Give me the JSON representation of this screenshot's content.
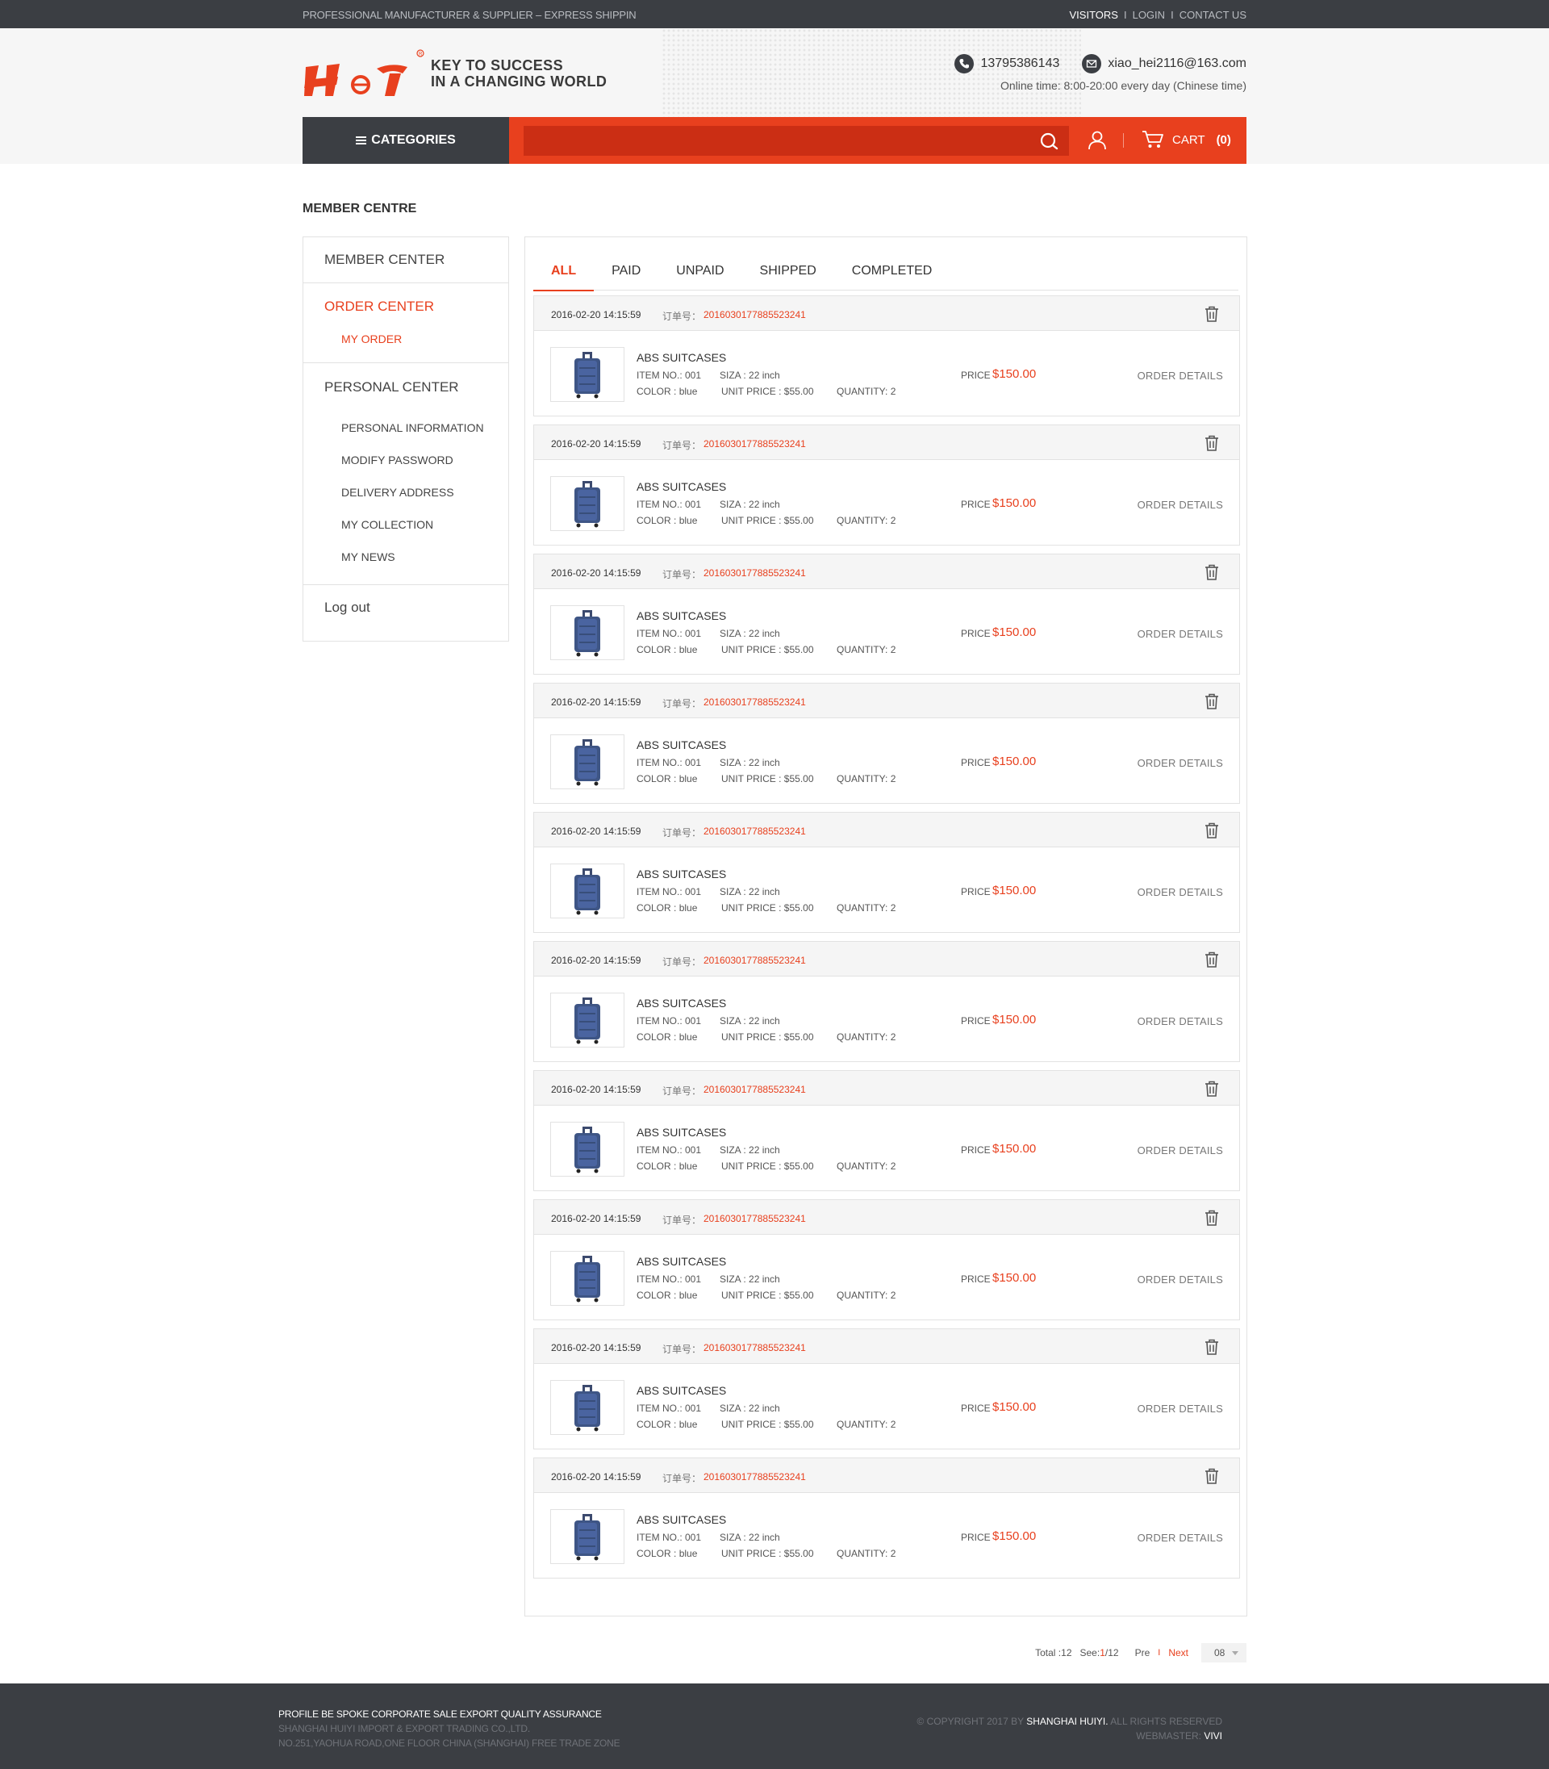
{
  "topbar": {
    "tagline": "PROFESSIONAL MANUFACTURER & SUPPLIER – EXPRESS SHIPPIN",
    "links": [
      "VISITORS",
      "LOGIN",
      "CONTACT US"
    ]
  },
  "header": {
    "logo_text": "H Y",
    "slogan_line1": "KEY TO SUCCESS",
    "slogan_line2": "IN A CHANGING WORLD",
    "phone": "13795386143",
    "email": "xiao_hei2116@163.com",
    "online_time": "Online time: 8:00-20:00 every day (Chinese time)"
  },
  "nav": {
    "categories_label": "CATEGORIES",
    "search_placeholder": "",
    "cart_label": "CART",
    "cart_count": "(0)"
  },
  "page_title": "MEMBER CENTRE",
  "sidebar": {
    "member_center": "MEMBER CENTER",
    "order_center": "ORDER CENTER",
    "my_order": "MY ORDER",
    "personal_center": "PERSONAL CENTER",
    "personal_items": [
      "PERSONAL INFORMATION",
      "MODIFY PASSWORD",
      "DELIVERY ADDRESS",
      "MY COLLECTION",
      "MY NEWS"
    ],
    "logout": "Log out"
  },
  "tabs": [
    "ALL",
    "PAID",
    "UNPAID",
    "SHIPPED",
    "COMPLETED"
  ],
  "order_labels": {
    "order_no_label": "订单号：",
    "item_no_label": "ITEM NO.: ",
    "size_label": "SIZA : ",
    "color_label": "COLOR : ",
    "unit_price_label": "UNIT PRICE : ",
    "quantity_label": "QUANTITY: ",
    "price_label": "PRICE",
    "details_label": "ORDER DETAILS"
  },
  "orders": [
    {
      "date": "2016-02-20 14:15:59",
      "order_no": "2016030177885523241",
      "product": "ABS SUITCASES",
      "item_no": "001",
      "size": "22 inch",
      "color": "blue",
      "unit_price": "$55.00",
      "quantity": "2",
      "price": "$150.00"
    },
    {
      "date": "2016-02-20 14:15:59",
      "order_no": "2016030177885523241",
      "product": "ABS SUITCASES",
      "item_no": "001",
      "size": "22 inch",
      "color": "blue",
      "unit_price": "$55.00",
      "quantity": "2",
      "price": "$150.00"
    },
    {
      "date": "2016-02-20 14:15:59",
      "order_no": "2016030177885523241",
      "product": "ABS SUITCASES",
      "item_no": "001",
      "size": "22 inch",
      "color": "blue",
      "unit_price": "$55.00",
      "quantity": "2",
      "price": "$150.00"
    },
    {
      "date": "2016-02-20 14:15:59",
      "order_no": "2016030177885523241",
      "product": "ABS SUITCASES",
      "item_no": "001",
      "size": "22 inch",
      "color": "blue",
      "unit_price": "$55.00",
      "quantity": "2",
      "price": "$150.00"
    },
    {
      "date": "2016-02-20 14:15:59",
      "order_no": "2016030177885523241",
      "product": "ABS SUITCASES",
      "item_no": "001",
      "size": "22 inch",
      "color": "blue",
      "unit_price": "$55.00",
      "quantity": "2",
      "price": "$150.00"
    },
    {
      "date": "2016-02-20 14:15:59",
      "order_no": "2016030177885523241",
      "product": "ABS SUITCASES",
      "item_no": "001",
      "size": "22 inch",
      "color": "blue",
      "unit_price": "$55.00",
      "quantity": "2",
      "price": "$150.00"
    },
    {
      "date": "2016-02-20 14:15:59",
      "order_no": "2016030177885523241",
      "product": "ABS SUITCASES",
      "item_no": "001",
      "size": "22 inch",
      "color": "blue",
      "unit_price": "$55.00",
      "quantity": "2",
      "price": "$150.00"
    },
    {
      "date": "2016-02-20 14:15:59",
      "order_no": "2016030177885523241",
      "product": "ABS SUITCASES",
      "item_no": "001",
      "size": "22 inch",
      "color": "blue",
      "unit_price": "$55.00",
      "quantity": "2",
      "price": "$150.00"
    },
    {
      "date": "2016-02-20 14:15:59",
      "order_no": "2016030177885523241",
      "product": "ABS SUITCASES",
      "item_no": "001",
      "size": "22 inch",
      "color": "blue",
      "unit_price": "$55.00",
      "quantity": "2",
      "price": "$150.00"
    },
    {
      "date": "2016-02-20 14:15:59",
      "order_no": "2016030177885523241",
      "product": "ABS SUITCASES",
      "item_no": "001",
      "size": "22 inch",
      "color": "blue",
      "unit_price": "$55.00",
      "quantity": "2",
      "price": "$150.00"
    }
  ],
  "pagination": {
    "total_label": "Total : ",
    "total": "12",
    "see_label": "See: ",
    "current": "1",
    "of": "/12",
    "prev": "Pre",
    "next": "Next",
    "per_page": "08"
  },
  "footer": {
    "line1": "PROFILE BE SPOKE CORPORATE SALE EXPORT QUALITY ASSURANCE",
    "line2": "SHANGHAI HUIYI IMPORT & EXPORT  TRADING CO.,LTD.",
    "line3": "NO.251,YAOHUA ROAD,ONE FLOOR  CHINA (SHANGHAI) FREE TRADE ZONE",
    "copyright_prefix": "© COPYRIGHT 2017 BY ",
    "company": "SHANGHAI HUIYI.",
    "rights": " ALL RIGHTS RESERVED",
    "webmaster_label": "WEBMASTER: ",
    "webmaster": "VIVI"
  },
  "colors": {
    "accent": "#e8401e",
    "dark": "#3b3e43",
    "search_bg": "#cb2e14"
  }
}
